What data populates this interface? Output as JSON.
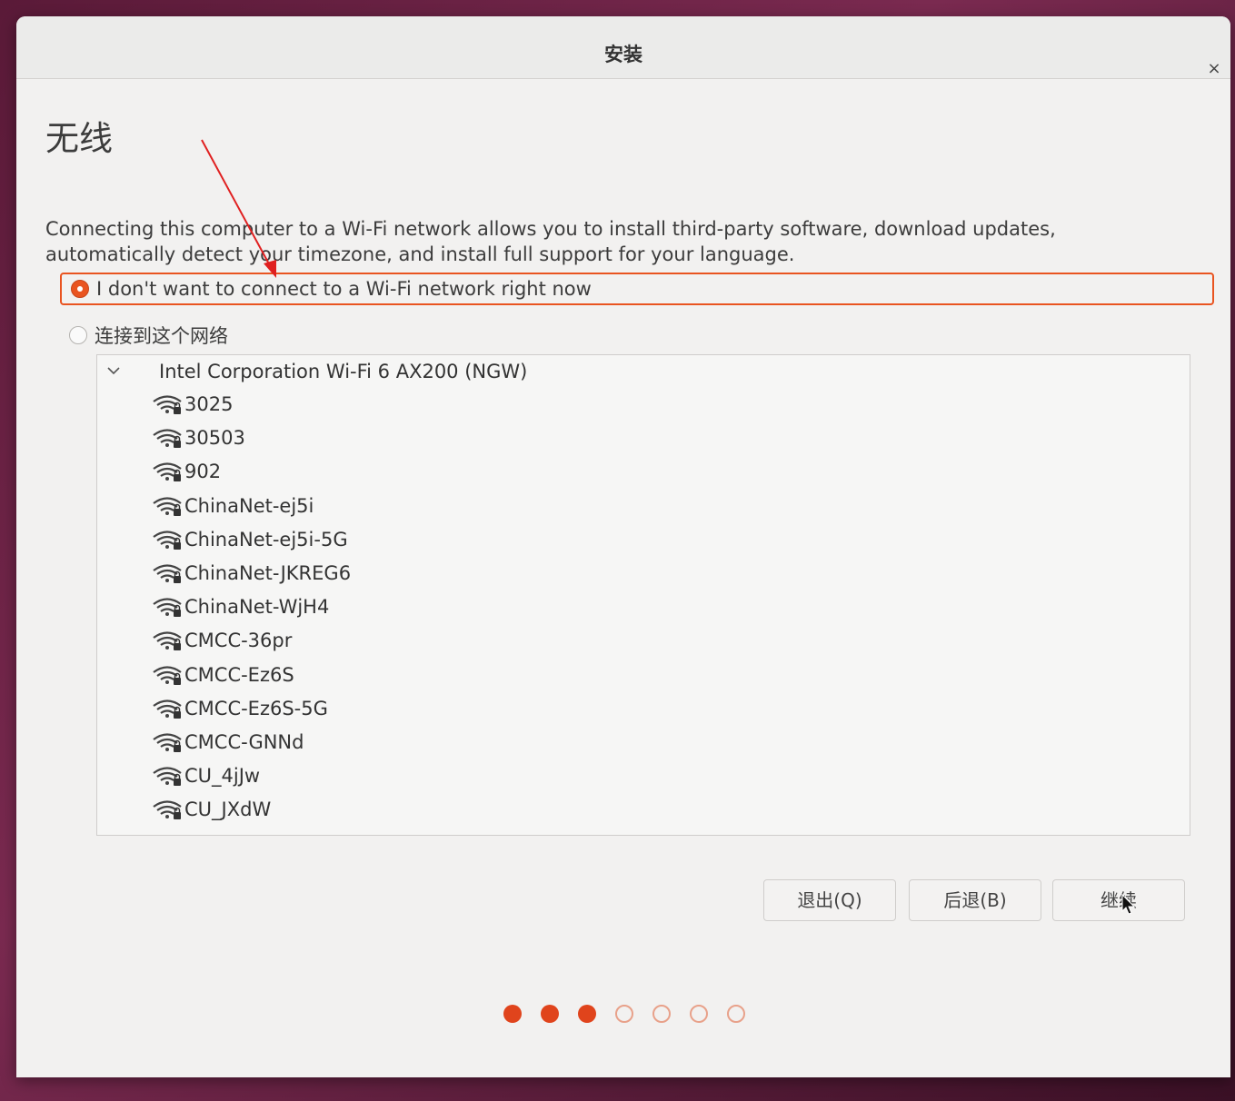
{
  "window": {
    "title": "安装",
    "close_glyph": "×"
  },
  "page": {
    "heading": "无线",
    "description": "Connecting this computer to a Wi-Fi network allows you to install third-party software, download updates, automatically detect your timezone, and install full support for your language."
  },
  "options": {
    "no_wifi": {
      "label": "I don't want to connect to a Wi-Fi network right now",
      "selected": true
    },
    "connect": {
      "label": "连接到这个网络",
      "selected": false
    }
  },
  "network_list": {
    "device": "Intel Corporation Wi-Fi 6 AX200 (NGW)",
    "networks": [
      "3025",
      "30503",
      "902",
      "ChinaNet-ej5i",
      "ChinaNet-ej5i-5G",
      "ChinaNet-JKREG6",
      "ChinaNet-WjH4",
      "CMCC-36pr",
      "CMCC-Ez6S",
      "CMCC-Ez6S-5G",
      "CMCC-GNNd",
      "CU_4jJw",
      "CU_JXdW"
    ]
  },
  "buttons": {
    "quit": "退出(Q)",
    "back": "后退(B)",
    "continue": "继续"
  },
  "progress": {
    "total_steps": 7,
    "current_step": 3
  },
  "colors": {
    "accent": "#e95420",
    "annotation": "#e02020"
  }
}
